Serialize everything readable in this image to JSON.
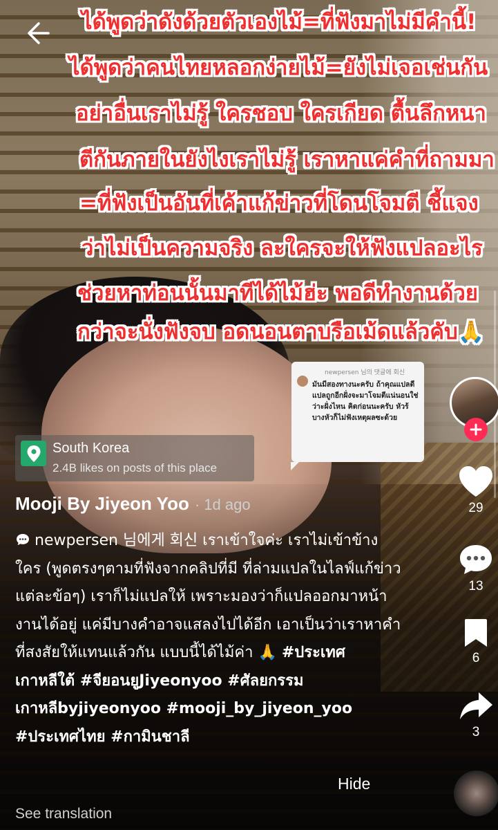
{
  "overlay_lines": [
    "ได้พูดว่าดังด้วยตัวเองไม้=ที่ฟังมาไม่มีคำนี้!",
    "ได้พูดว่าคนไทยหลอกง่ายไม้=ยังไม่เจอเช่นกัน",
    "อย่าอื่นเราไม่รู้ ใครชอบ ใครเกียด ตื้นลึกหนา",
    "ตีกันภายในยังไงเราไม่รู้ เราหาแค่คำที่ถามมา",
    "=ที่ฟังเป็นอันที่เค้าแก้ข่าวที่โดนโจมตี ชี้แจง",
    "ว่าไม่เป็นความจริง ละใครจะให้ฟังแปลอะไร",
    "ช่วยหาท่อนนั้นมาทีได้ไม้ฮ่ะ พอดีทำงานด้วย",
    "กว่าจะนั่งฟังจบ อดนอนตาบรือเม้ดแล้วคับ🙏"
  ],
  "reply_card": {
    "header": "newpersen 님의 댓글에 회신",
    "text": "มันมีสองทางนะครับ ถ้าคุณแปลดีแปลถูกอีกฝั่งจะมาโจมตีแน่นอนใช่ว่าะฝั่งไหน คิดก่อนนะครับ หัวร้บางหัวก็ไม่ฟังเหตุผลซะด้วย"
  },
  "location": {
    "name": "South Korea",
    "likes": "2.4B likes on posts of this place"
  },
  "author": {
    "name": "Mooji By Jiyeon Yoo",
    "time": "· 1d ago"
  },
  "description": {
    "reply_to": "newpersen",
    "reply_label": "님에게 회신",
    "body": "เราเข้าใจค่ะ เราไม่เข้าข้างใคร (พูดตรงๆตามที่ฟังจากคลิปที่มี ที่ล่ามแปลในไลฟ์แก้ข่าวแต่ละข้อๆ) เราก็ไม่แปลให้ เพราะมองว่าก็แปลออกมาหน้างานได้อยู่ แค่มีบางคำอาจแสลงไปได้อีก เอาเป็นว่าเราหาคำที่สงสัยให้แทนแล้วกัน แบบนี้ได้ไม้ค่า 🙏",
    "hashtags": "#ประเทศเกาหลีใต้ #จียอนยูJiyeonyoo #ศัลยกรรมเกาหลีbyjiyeonyoo #mooji_by_jiyeon_yoo #ประเทศไทย #กามินชาลี"
  },
  "actions": {
    "likes": "29",
    "comments": "13",
    "bookmarks": "6",
    "shares": "3"
  },
  "hide_label": "Hide",
  "see_translation": "See translation",
  "colors": {
    "overlay_red": "#ee2f2f",
    "follow_pink": "#fe2c55",
    "location_green": "#25a86c"
  },
  "icons": {
    "back": "arrow-left-icon",
    "location": "map-pin-icon",
    "like": "heart-icon",
    "comment": "comment-bubble-icon",
    "bookmark": "bookmark-icon",
    "share": "share-arrow-icon",
    "follow": "plus-icon"
  }
}
